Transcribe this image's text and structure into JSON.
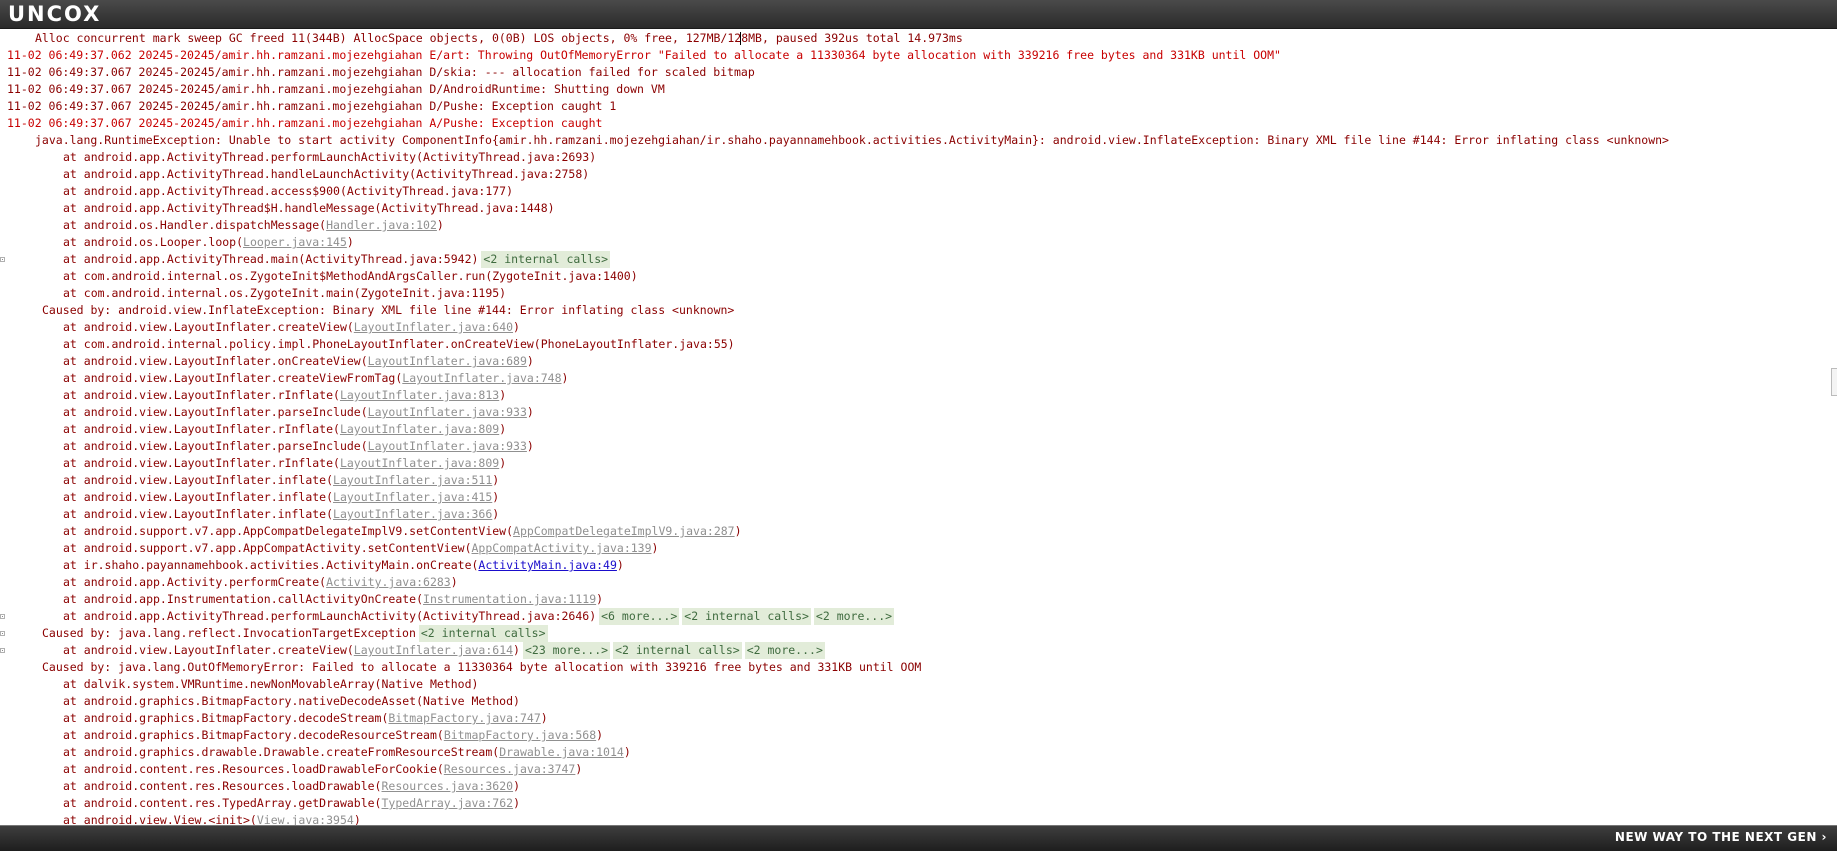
{
  "header": {
    "logo": "UNCOX"
  },
  "footer": {
    "tagline": "NEW WAY TO THE NEXT GEN ›"
  },
  "log": {
    "lines": [
      {
        "cls": "i1",
        "parts": [
          {
            "t": "Alloc concurrent mark sweep GC freed 11(344B) AllocSpace objects, 0(0B) LOS objects, 0% free, 127MB/128MB, paused 392us total 14.973ms"
          }
        ]
      },
      {
        "cls": "i0 red",
        "parts": [
          {
            "t": "11-02 06:49:37.062 20245-20245/amir.hh.ramzani.mojezehgiahan E/art: Throwing OutOfMemoryError \"Failed to allocate a 11330364 byte allocation with 339216 free bytes and 331KB until OOM\""
          }
        ]
      },
      {
        "cls": "i0",
        "parts": [
          {
            "t": "11-02 06:49:37.067 20245-20245/amir.hh.ramzani.mojezehgiahan D/skia: --- allocation failed for scaled bitmap"
          }
        ]
      },
      {
        "cls": "i0",
        "parts": [
          {
            "t": "11-02 06:49:37.067 20245-20245/amir.hh.ramzani.mojezehgiahan D/AndroidRuntime: Shutting down VM"
          }
        ]
      },
      {
        "cls": "i0",
        "parts": [
          {
            "t": "11-02 06:49:37.067 20245-20245/amir.hh.ramzani.mojezehgiahan D/Pushe: Exception caught 1"
          }
        ]
      },
      {
        "cls": "i0 red",
        "parts": [
          {
            "t": "11-02 06:49:37.067 20245-20245/amir.hh.ramzani.mojezehgiahan A/Pushe: Exception caught"
          }
        ]
      },
      {
        "cls": "i1",
        "parts": [
          {
            "t": "java.lang.RuntimeException: Unable to start activity ComponentInfo{amir.hh.ramzani.mojezehgiahan/ir.shaho.payannamehbook.activities.ActivityMain}: android.view.InflateException: Binary XML file line #144: Error inflating class <unknown>"
          }
        ]
      },
      {
        "cls": "i2",
        "parts": [
          {
            "t": "at android.app.ActivityThread.performLaunchActivity(ActivityThread.java:2693)"
          }
        ]
      },
      {
        "cls": "i2",
        "parts": [
          {
            "t": "at android.app.ActivityThread.handleLaunchActivity(ActivityThread.java:2758)"
          }
        ]
      },
      {
        "cls": "i2",
        "parts": [
          {
            "t": "at android.app.ActivityThread.access$900(ActivityThread.java:177)"
          }
        ]
      },
      {
        "cls": "i2",
        "parts": [
          {
            "t": "at android.app.ActivityThread$H.handleMessage(ActivityThread.java:1448)"
          }
        ]
      },
      {
        "cls": "i2",
        "parts": [
          {
            "t": "at android.os.Handler.dispatchMessage("
          },
          {
            "t": "Handler.java:102",
            "k": "src"
          },
          {
            "t": ")"
          }
        ]
      },
      {
        "cls": "i2",
        "parts": [
          {
            "t": "at android.os.Looper.loop("
          },
          {
            "t": "Looper.java:145",
            "k": "src"
          },
          {
            "t": ")"
          }
        ]
      },
      {
        "cls": "i2",
        "exp": true,
        "parts": [
          {
            "t": "at android.app.ActivityThread.main(ActivityThread.java:5942)"
          },
          {
            "t": "<2 internal calls>",
            "k": "fold"
          }
        ]
      },
      {
        "cls": "i2",
        "parts": [
          {
            "t": "at com.android.internal.os.ZygoteInit$MethodAndArgsCaller.run(ZygoteInit.java:1400)"
          }
        ]
      },
      {
        "cls": "i2",
        "parts": [
          {
            "t": "at com.android.internal.os.ZygoteInit.main(ZygoteInit.java:1195)"
          }
        ]
      },
      {
        "cls": "i1b",
        "parts": [
          {
            "t": "Caused by: android.view.InflateException: Binary XML file line #144: Error inflating class <unknown>"
          }
        ]
      },
      {
        "cls": "i2",
        "parts": [
          {
            "t": "at android.view.LayoutInflater.createView("
          },
          {
            "t": "LayoutInflater.java:640",
            "k": "src"
          },
          {
            "t": ")"
          }
        ]
      },
      {
        "cls": "i2",
        "parts": [
          {
            "t": "at com.android.internal.policy.impl.PhoneLayoutInflater.onCreateView(PhoneLayoutInflater.java:55)"
          }
        ]
      },
      {
        "cls": "i2",
        "parts": [
          {
            "t": "at android.view.LayoutInflater.onCreateView("
          },
          {
            "t": "LayoutInflater.java:689",
            "k": "src"
          },
          {
            "t": ")"
          }
        ]
      },
      {
        "cls": "i2",
        "parts": [
          {
            "t": "at android.view.LayoutInflater.createViewFromTag("
          },
          {
            "t": "LayoutInflater.java:748",
            "k": "src"
          },
          {
            "t": ")"
          }
        ]
      },
      {
        "cls": "i2",
        "parts": [
          {
            "t": "at android.view.LayoutInflater.rInflate("
          },
          {
            "t": "LayoutInflater.java:813",
            "k": "src"
          },
          {
            "t": ")"
          }
        ]
      },
      {
        "cls": "i2",
        "parts": [
          {
            "t": "at android.view.LayoutInflater.parseInclude("
          },
          {
            "t": "LayoutInflater.java:933",
            "k": "src"
          },
          {
            "t": ")"
          }
        ]
      },
      {
        "cls": "i2",
        "parts": [
          {
            "t": "at android.view.LayoutInflater.rInflate("
          },
          {
            "t": "LayoutInflater.java:809",
            "k": "src"
          },
          {
            "t": ")"
          }
        ]
      },
      {
        "cls": "i2",
        "parts": [
          {
            "t": "at android.view.LayoutInflater.parseInclude("
          },
          {
            "t": "LayoutInflater.java:933",
            "k": "src"
          },
          {
            "t": ")"
          }
        ]
      },
      {
        "cls": "i2",
        "parts": [
          {
            "t": "at android.view.LayoutInflater.rInflate("
          },
          {
            "t": "LayoutInflater.java:809",
            "k": "src"
          },
          {
            "t": ")"
          }
        ]
      },
      {
        "cls": "i2",
        "parts": [
          {
            "t": "at android.view.LayoutInflater.inflate("
          },
          {
            "t": "LayoutInflater.java:511",
            "k": "src"
          },
          {
            "t": ")"
          }
        ]
      },
      {
        "cls": "i2",
        "parts": [
          {
            "t": "at android.view.LayoutInflater.inflate("
          },
          {
            "t": "LayoutInflater.java:415",
            "k": "src"
          },
          {
            "t": ")"
          }
        ]
      },
      {
        "cls": "i2",
        "parts": [
          {
            "t": "at android.view.LayoutInflater.inflate("
          },
          {
            "t": "LayoutInflater.java:366",
            "k": "src"
          },
          {
            "t": ")"
          }
        ]
      },
      {
        "cls": "i2",
        "parts": [
          {
            "t": "at android.support.v7.app.AppCompatDelegateImplV9.setContentView("
          },
          {
            "t": "AppCompatDelegateImplV9.java:287",
            "k": "src"
          },
          {
            "t": ")"
          }
        ]
      },
      {
        "cls": "i2",
        "parts": [
          {
            "t": "at android.support.v7.app.AppCompatActivity.setContentView("
          },
          {
            "t": "AppCompatActivity.java:139",
            "k": "src"
          },
          {
            "t": ")"
          }
        ]
      },
      {
        "cls": "i2",
        "parts": [
          {
            "t": "at ir.shaho.payannamehbook.activities.ActivityMain.onCreate("
          },
          {
            "t": "ActivityMain.java:49",
            "k": "link"
          },
          {
            "t": ")"
          }
        ]
      },
      {
        "cls": "i2",
        "parts": [
          {
            "t": "at android.app.Activity.performCreate("
          },
          {
            "t": "Activity.java:6283",
            "k": "src"
          },
          {
            "t": ")"
          }
        ]
      },
      {
        "cls": "i2",
        "parts": [
          {
            "t": "at android.app.Instrumentation.callActivityOnCreate("
          },
          {
            "t": "Instrumentation.java:1119",
            "k": "src"
          },
          {
            "t": ")"
          }
        ]
      },
      {
        "cls": "i2",
        "exp": true,
        "parts": [
          {
            "t": "at android.app.ActivityThread.performLaunchActivity(ActivityThread.java:2646)"
          },
          {
            "t": "<6 more...>",
            "k": "fold"
          },
          {
            "t": "<2 internal calls>",
            "k": "fold"
          },
          {
            "t": "<2 more...>",
            "k": "fold"
          }
        ]
      },
      {
        "cls": "i1b",
        "exp": true,
        "parts": [
          {
            "t": "Caused by: java.lang.reflect.InvocationTargetException"
          },
          {
            "t": "<2 internal calls>",
            "k": "fold"
          }
        ]
      },
      {
        "cls": "i2",
        "exp": true,
        "parts": [
          {
            "t": "at android.view.LayoutInflater.createView("
          },
          {
            "t": "LayoutInflater.java:614",
            "k": "src"
          },
          {
            "t": ")"
          },
          {
            "t": "<23 more...>",
            "k": "fold"
          },
          {
            "t": "<2 internal calls>",
            "k": "fold"
          },
          {
            "t": "<2 more...>",
            "k": "fold"
          }
        ]
      },
      {
        "cls": "i1b",
        "parts": [
          {
            "t": "Caused by: java.lang.OutOfMemoryError: Failed to allocate a 11330364 byte allocation with 339216 free bytes and 331KB until OOM"
          }
        ]
      },
      {
        "cls": "i2",
        "parts": [
          {
            "t": "at dalvik.system.VMRuntime.newNonMovableArray(Native Method)"
          }
        ]
      },
      {
        "cls": "i2",
        "parts": [
          {
            "t": "at android.graphics.BitmapFactory.nativeDecodeAsset(Native Method)"
          }
        ]
      },
      {
        "cls": "i2",
        "parts": [
          {
            "t": "at android.graphics.BitmapFactory.decodeStream("
          },
          {
            "t": "BitmapFactory.java:747",
            "k": "src"
          },
          {
            "t": ")"
          }
        ]
      },
      {
        "cls": "i2",
        "parts": [
          {
            "t": "at android.graphics.BitmapFactory.decodeResourceStream("
          },
          {
            "t": "BitmapFactory.java:568",
            "k": "src"
          },
          {
            "t": ")"
          }
        ]
      },
      {
        "cls": "i2",
        "parts": [
          {
            "t": "at android.graphics.drawable.Drawable.createFromResourceStream("
          },
          {
            "t": "Drawable.java:1014",
            "k": "src"
          },
          {
            "t": ")"
          }
        ]
      },
      {
        "cls": "i2",
        "parts": [
          {
            "t": "at android.content.res.Resources.loadDrawableForCookie("
          },
          {
            "t": "Resources.java:3747",
            "k": "src"
          },
          {
            "t": ")"
          }
        ]
      },
      {
        "cls": "i2",
        "parts": [
          {
            "t": "at android.content.res.Resources.loadDrawable("
          },
          {
            "t": "Resources.java:3620",
            "k": "src"
          },
          {
            "t": ")"
          }
        ]
      },
      {
        "cls": "i2",
        "parts": [
          {
            "t": "at android.content.res.TypedArray.getDrawable("
          },
          {
            "t": "TypedArray.java:762",
            "k": "src"
          },
          {
            "t": ")"
          }
        ]
      },
      {
        "cls": "i2",
        "parts": [
          {
            "t": "at android.view.View.<init>("
          },
          {
            "t": "View.java:3954",
            "k": "src"
          },
          {
            "t": ")"
          }
        ]
      }
    ]
  }
}
